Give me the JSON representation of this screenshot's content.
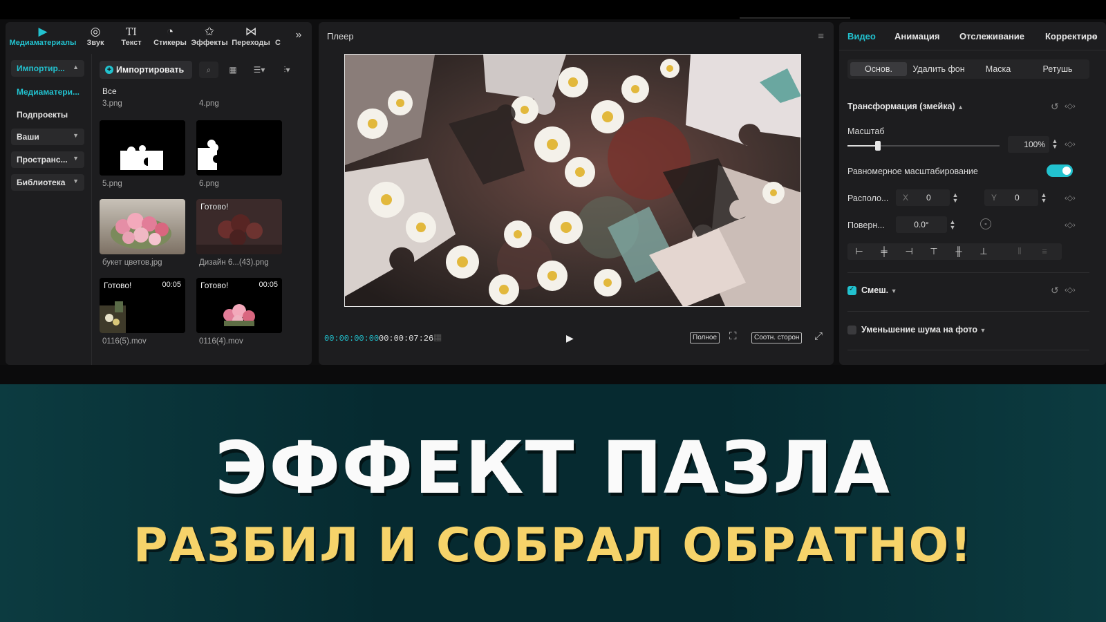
{
  "top_tabs": [
    {
      "label": "Медиаматериалы",
      "icon": "media-icon",
      "active": true
    },
    {
      "label": "Звук",
      "icon": "audio-icon"
    },
    {
      "label": "Текст",
      "icon": "text-icon"
    },
    {
      "label": "Стикеры",
      "icon": "sticker-icon"
    },
    {
      "label": "Эффекты",
      "icon": "effects-icon"
    },
    {
      "label": "Переходы",
      "icon": "transitions-icon"
    },
    {
      "label": "С"
    }
  ],
  "sidebar": {
    "import": "Импортир...",
    "media": "Медиаматери...",
    "subprojects": "Подпроекты",
    "yours": "Ваши",
    "spaces": "Пространс...",
    "library": "Библиотека"
  },
  "media_panel": {
    "import_label": "Импортировать",
    "category": "Все",
    "items": [
      {
        "label": "3.png"
      },
      {
        "label": "4.png"
      },
      {
        "label": "5.png"
      },
      {
        "label": "6.png"
      },
      {
        "label": "букет цветов.jpg"
      },
      {
        "label": "Дизайн 6...(43).png",
        "badge": "Готово!"
      },
      {
        "label": "0116(5).mov",
        "badge": "Готово!",
        "duration": "00:05"
      },
      {
        "label": "0116(4).mov",
        "badge": "Готово!",
        "duration": "00:05"
      }
    ]
  },
  "player": {
    "title": "Плеер",
    "current_time": "00:00:00:00",
    "total_time": "00:00:07:26",
    "full_label": "Полное",
    "aspect_label": "Соотн. сторон"
  },
  "inspector": {
    "tabs": [
      "Видео",
      "Анимация",
      "Отслеживание",
      "Корректиро"
    ],
    "subtabs": [
      "Основ.",
      "Удалить фон",
      "Маска",
      "Ретушь"
    ],
    "transform_title": "Трансформация (змейка)",
    "scale_label": "Масштаб",
    "scale_value": "100%",
    "scale_fraction": 0.2,
    "uniform_label": "Равномерное масштабирование",
    "position_label": "Располо...",
    "x_label": "X",
    "x_value": "0",
    "y_label": "Y",
    "y_value": "0",
    "rotate_label": "Поверн...",
    "rotate_value": "0.0°",
    "blend_label": "Смеш.",
    "denoise_label": "Уменьшение шума на фото"
  },
  "banner": {
    "title": "ЭФФЕКТ ПАЗЛА",
    "subtitle": "РАЗБИЛ И СОБРАЛ ОБРАТНО!"
  },
  "colors": {
    "accent": "#22c2cf",
    "subtitle": "#f6d36a",
    "banner_bg": "#062a30"
  }
}
